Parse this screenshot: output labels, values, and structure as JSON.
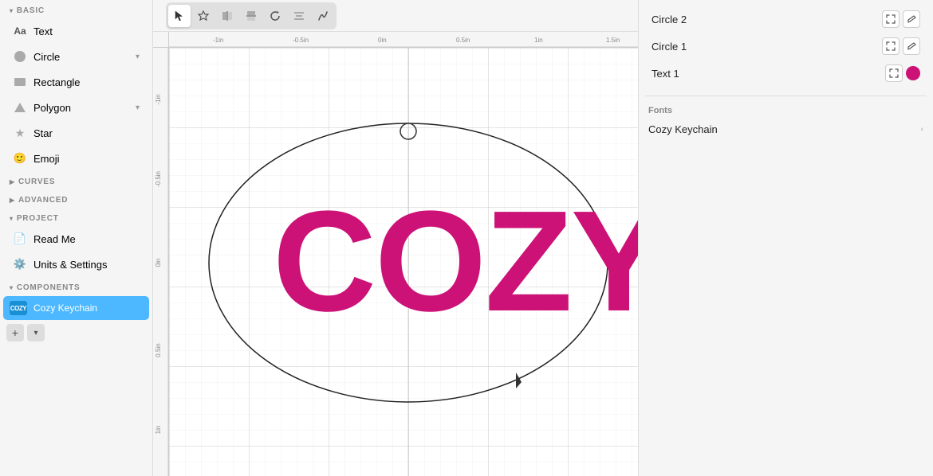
{
  "sidebar": {
    "section_basic": "BASIC",
    "section_curves": "CURVES",
    "section_advanced": "ADVANCED",
    "section_project": "PROJECT",
    "section_components": "COMPONENTS",
    "items_basic": [
      {
        "id": "text",
        "label": "Text",
        "icon": "text-aa"
      },
      {
        "id": "circle",
        "label": "Circle",
        "icon": "circle"
      },
      {
        "id": "rectangle",
        "label": "Rectangle",
        "icon": "rect"
      },
      {
        "id": "polygon",
        "label": "Polygon",
        "icon": "polygon"
      },
      {
        "id": "star",
        "label": "Star",
        "icon": "star"
      },
      {
        "id": "emoji",
        "label": "Emoji",
        "icon": "emoji"
      }
    ],
    "items_project": [
      {
        "id": "readme",
        "label": "Read Me",
        "icon": "readme"
      },
      {
        "id": "units",
        "label": "Units & Settings",
        "icon": "settings"
      }
    ],
    "component_label": "Cozy Keychain",
    "component_icon_text": "COZY",
    "add_button": "+",
    "dropdown_button": "▾"
  },
  "toolbar": {
    "buttons": [
      {
        "id": "select",
        "icon": "▶",
        "active": true
      },
      {
        "id": "node",
        "icon": "✦",
        "active": false
      },
      {
        "id": "flip-h",
        "icon": "⇔",
        "active": false
      },
      {
        "id": "flip-v",
        "icon": "⇕",
        "active": false
      },
      {
        "id": "rotate",
        "icon": "↺",
        "active": false
      },
      {
        "id": "align",
        "icon": "⊞",
        "active": false
      },
      {
        "id": "path",
        "icon": "⟳",
        "active": false
      }
    ]
  },
  "canvas": {
    "ruler_labels_top": [
      "-1in",
      "-0.5in",
      "0in",
      "0.5in",
      "1in",
      "1.5in"
    ],
    "ruler_labels_left": [
      "-1in",
      "-0.5in",
      "0in",
      "0.5in",
      "1in"
    ],
    "cozy_text": "COZY",
    "cozy_color": "#CC1177"
  },
  "right_panel": {
    "layers": [
      {
        "id": "circle2",
        "label": "Circle 2"
      },
      {
        "id": "circle1",
        "label": "Circle 1"
      },
      {
        "id": "text1",
        "label": "Text 1",
        "color": "#CC1177"
      }
    ],
    "fonts_label": "Fonts",
    "font_name": "Cozy Keychain"
  }
}
